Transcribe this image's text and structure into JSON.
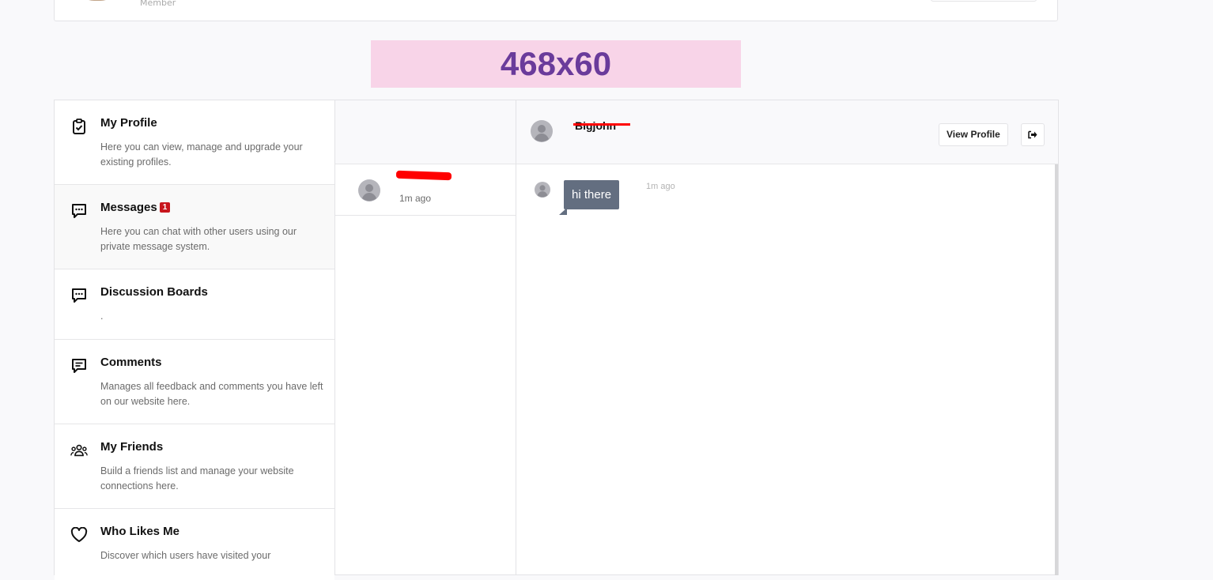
{
  "top_card": {
    "role": "Member"
  },
  "ad_banner": {
    "text": "468x60"
  },
  "sidebar": {
    "items": [
      {
        "title": "My Profile",
        "desc": "Here you can view, manage and upgrade your existing profiles.",
        "icon": "clipboard-check-icon"
      },
      {
        "title": "Messages",
        "badge": "1",
        "desc": "Here you can chat with other users using our private message system.",
        "icon": "chat-icon"
      },
      {
        "title": "Discussion Boards",
        "desc": ".",
        "icon": "chat-icon"
      },
      {
        "title": "Comments",
        "desc": "Manages all feedback and comments you have left on our website here.",
        "icon": "comment-icon"
      },
      {
        "title": "My Friends",
        "desc": "Build a friends list and manage your website connections here.",
        "icon": "users-icon"
      },
      {
        "title": "Who Likes Me",
        "desc": "Discover which users have visited your",
        "icon": "heart-icon"
      }
    ]
  },
  "conversations": [
    {
      "time": "1m ago"
    }
  ],
  "chat": {
    "header_name": "Bigjohn",
    "view_profile_label": "View Profile",
    "messages": [
      {
        "text": "hi there",
        "time": "1m ago"
      }
    ]
  },
  "colors": {
    "badge": "#c8161d",
    "bubble": "#636e80",
    "ad_bg": "#f8d4e8",
    "ad_text": "#6a3b9b"
  }
}
